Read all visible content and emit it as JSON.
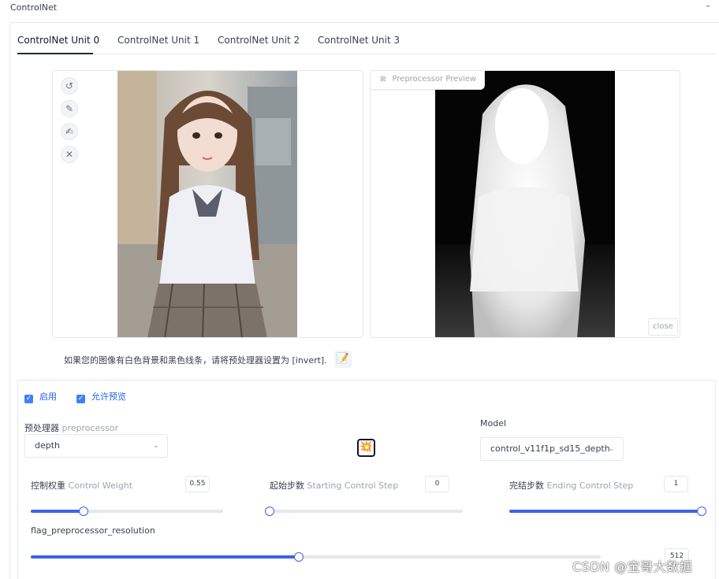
{
  "accordion": {
    "title": "ControlNet",
    "caret": "⌄"
  },
  "tabs": [
    {
      "label": "ControlNet Unit 0",
      "active": true
    },
    {
      "label": "ControlNet Unit 1",
      "active": false
    },
    {
      "label": "ControlNet Unit 2",
      "active": false
    },
    {
      "label": "ControlNet Unit 3",
      "active": false
    }
  ],
  "input_tools": {
    "undo_glyph": "↺",
    "edit_glyph": "✎",
    "brush_glyph": "✍",
    "clear_glyph": "✕"
  },
  "preview": {
    "label": "Preprocessor Preview",
    "icon": "image-icon",
    "close_label": "close"
  },
  "hint_text": "如果您的图像有白色背景和黑色线条，请将预处理器设置为 [invert].",
  "hint_button_glyph": "📝",
  "checkboxes": {
    "enable": {
      "label": "启用",
      "checked": true
    },
    "allow_preview": {
      "label": "允许预览",
      "checked": true
    }
  },
  "preprocessor": {
    "label_zh": "预处理器",
    "label_en": "preprocessor",
    "value": "depth"
  },
  "swap_button_glyph": "💥",
  "model": {
    "label": "Model",
    "value": "control_v11f1p_sd15_depth"
  },
  "control_weight": {
    "label_zh": "控制权重",
    "label_en": "Control Weight",
    "value": "0.55",
    "fraction": 0.275
  },
  "starting_step": {
    "label_zh": "起始步数",
    "label_en": "Starting Control Step",
    "value": "0",
    "fraction": 0.0
  },
  "ending_step": {
    "label_zh": "完结步数",
    "label_en": "Ending Control Step",
    "value": "1",
    "fraction": 1.0
  },
  "preprocessor_resolution": {
    "label": "flag_preprocessor_resolution",
    "value": "512",
    "fraction": 0.47
  },
  "watermark": "CSDN @宝哥大数据",
  "colors": {
    "accent": "#3b63e6",
    "checkbox": "#3b82f6",
    "border": "#e5e7eb"
  }
}
